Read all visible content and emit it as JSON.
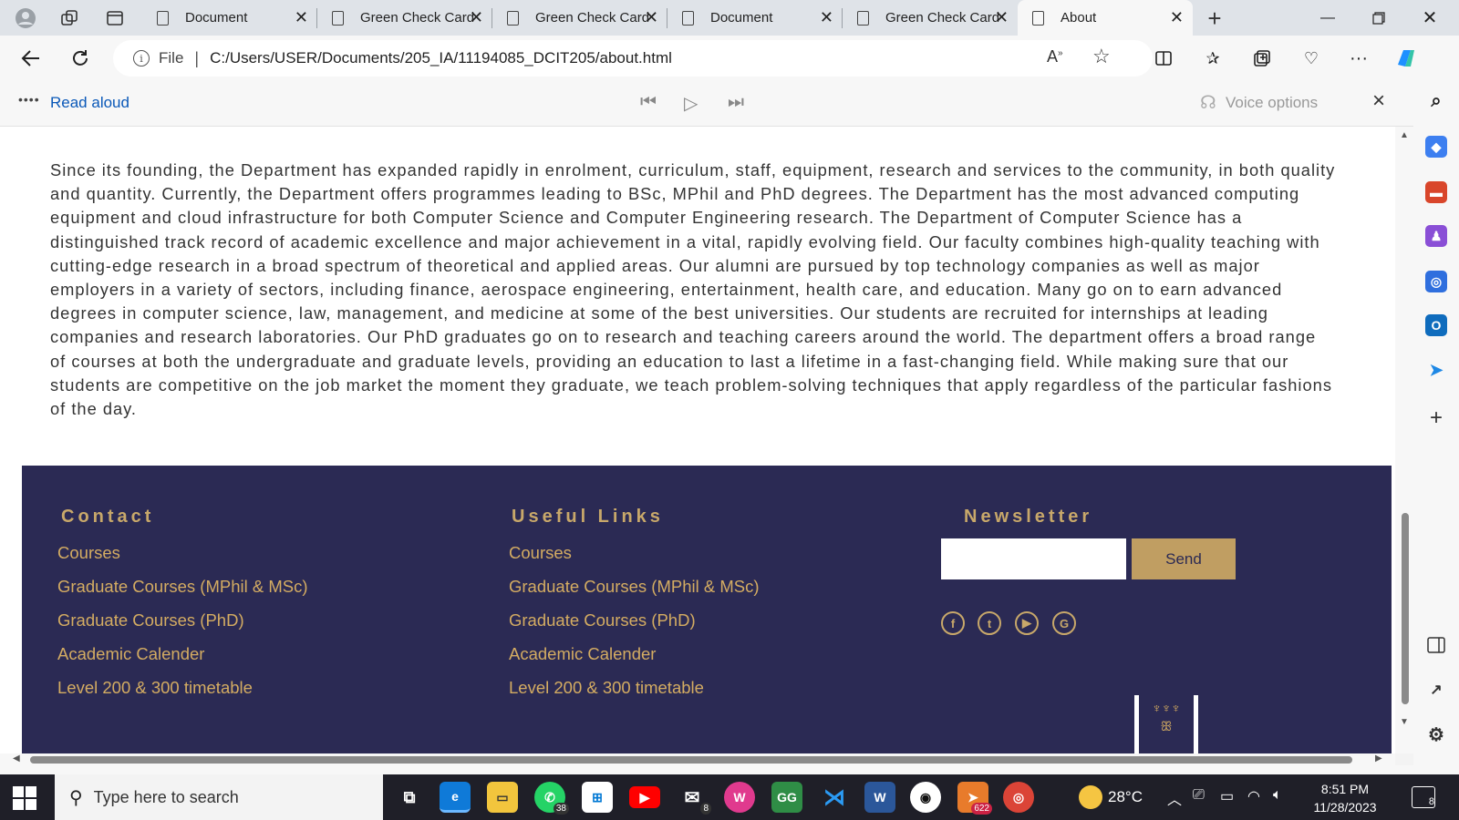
{
  "browser": {
    "tabs": [
      {
        "title": "Document",
        "active": false
      },
      {
        "title": "Green Check Card",
        "active": false
      },
      {
        "title": "Green Check Card",
        "active": false
      },
      {
        "title": "Document",
        "active": false
      },
      {
        "title": "Green Check Card",
        "active": false
      },
      {
        "title": "About",
        "active": true
      }
    ],
    "address": {
      "scheme_label": "File",
      "url": "C:/Users/USER/Documents/205_IA/11194085_DCIT205/about.html"
    },
    "read_aloud": {
      "label": "Read aloud",
      "voice_options": "Voice options"
    }
  },
  "page": {
    "about_paragraph": "Since its founding, the Department has expanded rapidly in enrolment, curriculum, staff, equipment, research and services to the community, in both quality and quantity. Currently, the Department offers programmes leading to BSc, MPhil and PhD degrees. The Department has the most advanced computing equipment and cloud infrastructure for both Computer Science and Computer Engineering research. The Department of Computer Science has a distinguished track record of academic excellence and major achievement in a vital, rapidly evolving field. Our faculty combines high-quality teaching with cutting-edge research in a broad spectrum of theoretical and applied areas. Our alumni are pursued by top technology companies as well as major employers in a variety of sectors, including finance, aerospace engineering, entertainment, health care, and education. Many go on to earn advanced degrees in computer science, law, management, and medicine at some of the best universities. Our students are recruited for internships at leading companies and research laboratories. Our PhD graduates go on to research and teaching careers around the world. The department offers a broad range of courses at both the undergraduate and graduate levels, providing an education to last a lifetime in a fast-changing field. While making sure that our students are competitive on the job market the moment they graduate, we teach problem-solving techniques that apply regardless of the particular fashions of the day.",
    "footer": {
      "contact": {
        "heading": "Contact",
        "links": [
          "Courses",
          "Graduate Courses (MPhil & MSc)",
          "Graduate Courses (PhD)",
          "Academic Calender",
          "Level 200 & 300 timetable"
        ]
      },
      "useful_links": {
        "heading": "Useful Links",
        "links": [
          "Courses",
          "Graduate Courses (MPhil & MSc)",
          "Graduate Courses (PhD)",
          "Academic Calender",
          "Level 200 & 300 timetable"
        ]
      },
      "newsletter": {
        "heading": "Newsletter",
        "input_value": "",
        "send_label": "Send"
      },
      "social_icons": [
        "facebook-icon",
        "twitter-icon",
        "youtube-icon",
        "geeksforgeeks-icon"
      ]
    }
  },
  "taskbar": {
    "search_placeholder": "Type here to search",
    "whatsapp_badge": "38",
    "mail_badge": "8",
    "telegram_badge": "622",
    "temperature": "28°C",
    "time": "8:51 PM",
    "date": "11/28/2023",
    "notification_count": "8"
  },
  "colors": {
    "footer_bg": "#2b2a54",
    "footer_accent": "#d4ac62",
    "send_button": "#c09e62"
  }
}
